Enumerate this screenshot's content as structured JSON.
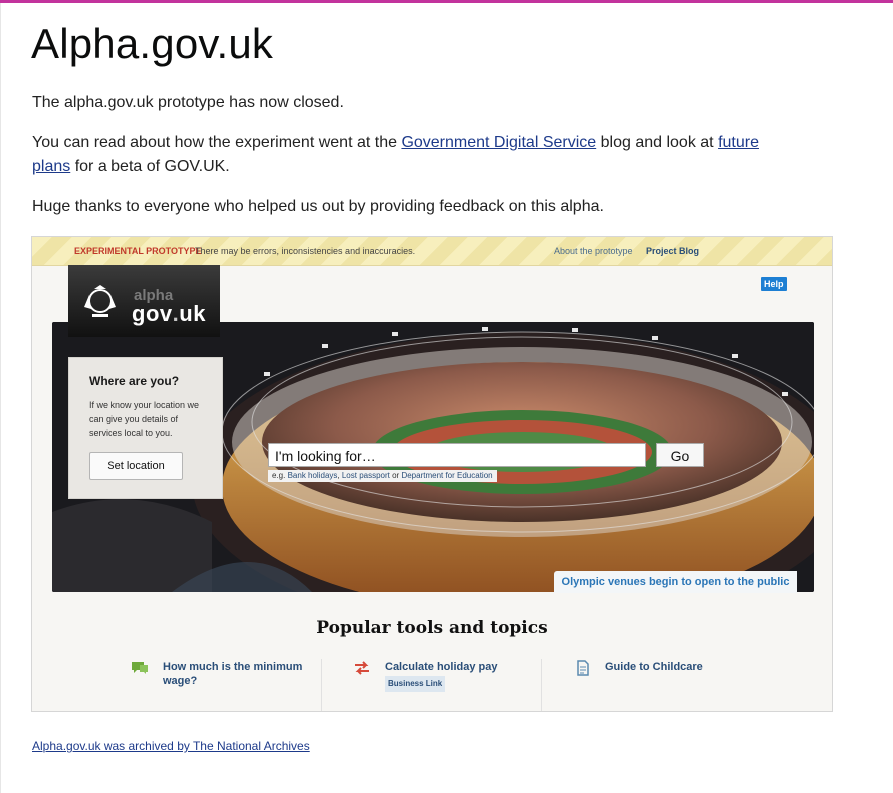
{
  "page": {
    "title": "Alpha.gov.uk",
    "p1": "The alpha.gov.uk prototype has now closed.",
    "p2_before": "You can read about how the experiment went at the ",
    "p2_link1": "Government Digital Service",
    "p2_middle": " blog and look at ",
    "p2_link2": "future plans",
    "p2_after": " for a beta of GOV.UK.",
    "p3": "Huge thanks to everyone who helped us out by providing feedback on this alpha.",
    "archive_link": "Alpha.gov.uk was archived by The National Archives"
  },
  "screenshot": {
    "banner": {
      "experimental": "EXPERIMENTAL PROTOTYPE",
      "warning": "There may be errors, inconsistencies and inaccuracies.",
      "about": "About the prototype",
      "blog": "Project Blog"
    },
    "help": "Help",
    "logo": {
      "alpha": "alpha",
      "gov": "gov",
      "dot": ".",
      "uk": "uk"
    },
    "where": {
      "heading": "Where are you?",
      "text": "If we know your location we can give you details of services local to you.",
      "button": "Set location"
    },
    "search": {
      "placeholder": "I'm looking for…",
      "go": "Go",
      "eg_prefix": "e.g. ",
      "eg1": "Bank holidays",
      "sep1": ", ",
      "eg2": "Lost passport",
      "sep2": " or ",
      "eg3": "Department for Education"
    },
    "olympic": "Olympic venues begin to open to the public",
    "popular_heading": "Popular tools and topics",
    "tools": [
      {
        "label": "How much is the minimum wage?",
        "icon": "speech-bubble-icon"
      },
      {
        "label": "Calculate holiday pay",
        "tag": "Business Link",
        "icon": "arrows-icon"
      },
      {
        "label": "Guide to Childcare",
        "icon": "document-icon"
      }
    ]
  },
  "colors": {
    "topbar": "#c2339c",
    "link": "#1d3a8a",
    "help": "#1d7fd3"
  }
}
